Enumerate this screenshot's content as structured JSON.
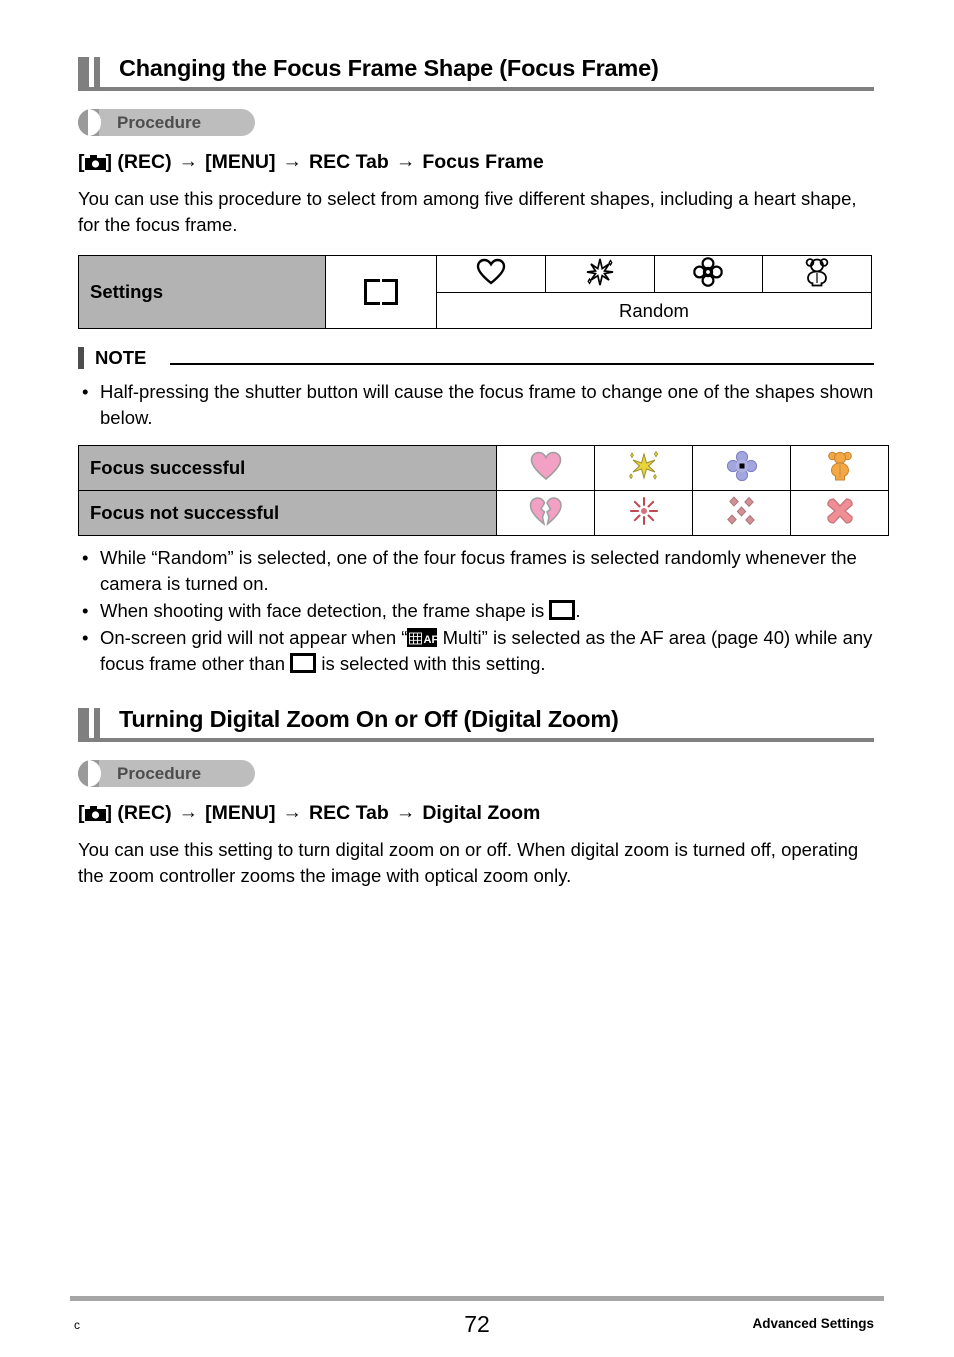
{
  "document": {
    "page_number": "72",
    "footer_left": "c",
    "footer_right": "Advanced Settings"
  },
  "sections": [
    {
      "heading": "Changing the Focus Frame Shape (Focus Frame)",
      "procedure_badge": "Procedure",
      "path": {
        "camera_icon": "camera-icon",
        "open_bracket": "[",
        "close_bracket": "]",
        "rec_label": "(REC)",
        "arrow": "→",
        "menu_label": "[MENU]",
        "tab_label": "REC Tab",
        "setting_label": "Focus Frame"
      },
      "intro": "You can use this procedure to select from among five different shapes, including a heart shape, for the focus frame.",
      "settings_table": {
        "row_label": "Settings",
        "frame_icon": "focus-frame-bracket-icon",
        "shape_icons": [
          "heart-outline-icon",
          "sparkle-outline-icon",
          "flower-outline-icon",
          "bear-outline-icon"
        ],
        "random_label": "Random"
      },
      "note": {
        "label": "NOTE",
        "bullets": [
          "Half-pressing the shutter button will cause the focus frame to change one of the shapes shown below."
        ]
      },
      "focus_table": {
        "rows": [
          {
            "label": "Focus successful",
            "icons": [
              "heart-pink-icon",
              "sparkle-yellow-icon",
              "flower-purple-icon",
              "bear-orange-icon"
            ]
          },
          {
            "label": "Focus not successful",
            "icons": [
              "broken-heart-icon",
              "burst-red-icon",
              "scattered-diamonds-icon",
              "x-mark-icon"
            ]
          }
        ]
      },
      "bullets": [
        {
          "parts": [
            {
              "type": "text",
              "value": "While “Random” is selected, one of the four focus frames is selected randomly whenever the camera is turned on."
            }
          ]
        },
        {
          "parts": [
            {
              "type": "text",
              "value": "When shooting with face detection, the frame shape is "
            },
            {
              "type": "icon",
              "value": "focus-frame-bracket-icon"
            },
            {
              "type": "text",
              "value": "."
            }
          ]
        },
        {
          "parts": [
            {
              "type": "text",
              "value": "On-screen grid will not appear when “"
            },
            {
              "type": "icon",
              "value": "multi-af-icon"
            },
            {
              "type": "text",
              "value": " Multi” is selected as the AF area (page 40) while any focus frame other than "
            },
            {
              "type": "icon",
              "value": "focus-frame-bracket-icon"
            },
            {
              "type": "text",
              "value": " is selected with this setting."
            }
          ]
        }
      ]
    },
    {
      "heading": "Turning Digital Zoom On or Off (Digital Zoom)",
      "procedure_badge": "Procedure",
      "path": {
        "camera_icon": "camera-icon",
        "open_bracket": "[",
        "close_bracket": "]",
        "rec_label": "(REC)",
        "arrow": "→",
        "menu_label": "[MENU]",
        "tab_label": "REC Tab",
        "setting_label": "Digital Zoom"
      },
      "intro": "You can use this setting to turn digital zoom on or off. When digital zoom is turned off, operating the zoom controller zooms the image with optical zoom only."
    }
  ],
  "colors": {
    "heading_bar": "#7f7f7f",
    "table_label_bg": "#b3b3b3",
    "badge_bg": "#bdbdbd",
    "footer_rule": "#a6a6a6",
    "heart_pink": "#f2a0c4",
    "sparkle_yellow": "#ead43c",
    "flower_purple": "#a3a5de",
    "bear_orange": "#f3a846",
    "fail_red": "#d4737a"
  }
}
